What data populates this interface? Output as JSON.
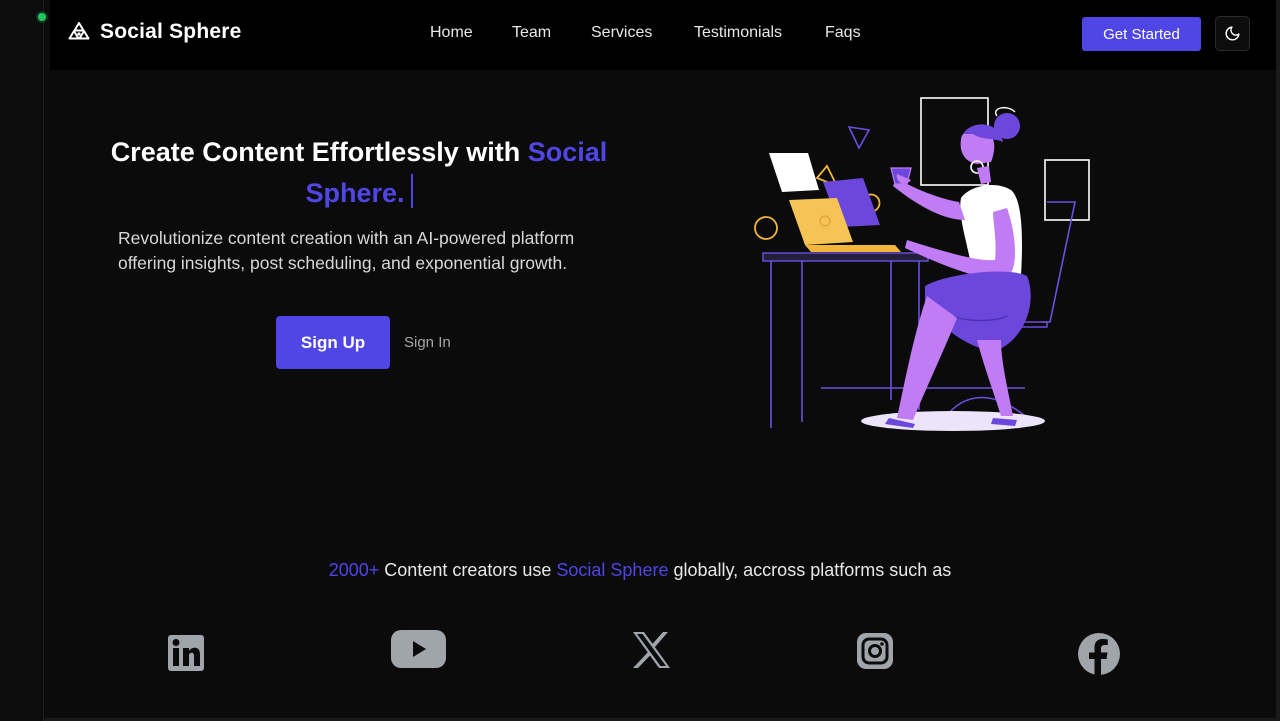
{
  "brand": {
    "name": "Social Sphere",
    "icon": "brand-logo-icon"
  },
  "nav": {
    "links": [
      {
        "label": "Home"
      },
      {
        "label": "Team"
      },
      {
        "label": "Services"
      },
      {
        "label": "Testimonials"
      },
      {
        "label": "Faqs"
      }
    ],
    "cta_label": "Get Started",
    "theme_toggle_icon": "moon-icon"
  },
  "hero": {
    "title_main": "Create Content Effortlessly with ",
    "title_accent": "Social Sphere.",
    "description": "Revolutionize content creation with an AI-powered platform offering insights, post scheduling, and exponential growth.",
    "signup_label": "Sign Up",
    "signin_label": "Sign In"
  },
  "stats": {
    "count": "2000+",
    "text_1": " Content creators use ",
    "brand": "Social Sphere",
    "text_2": " globally, accross platforms such as"
  },
  "platforms": [
    "linkedin-icon",
    "youtube-icon",
    "x-icon",
    "instagram-icon",
    "facebook-icon"
  ],
  "colors": {
    "accent": "#4f46e5",
    "background": "#0b0b0b",
    "navbar": "#000000",
    "icon_gray": "#a0a4ab"
  }
}
